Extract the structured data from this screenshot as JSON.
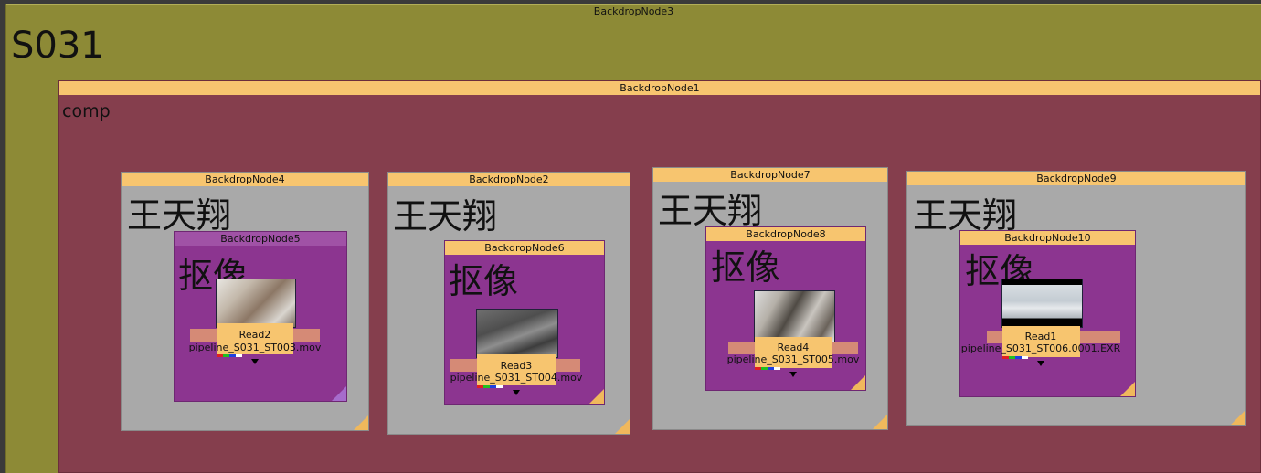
{
  "backdrop3": {
    "title": "BackdropNode3",
    "label": "S031"
  },
  "backdrop1": {
    "title": "BackdropNode1",
    "label": "comp"
  },
  "groups": [
    {
      "title": "BackdropNode4",
      "label": "王天翔",
      "inner": {
        "title": "BackdropNode5",
        "label": "抠像"
      },
      "read": {
        "name": "Read2",
        "file": "pipeline_S031_ST003.mov"
      }
    },
    {
      "title": "BackdropNode2",
      "label": "王天翔",
      "inner": {
        "title": "BackdropNode6",
        "label": "抠像"
      },
      "read": {
        "name": "Read3",
        "file": "pipeline_S031_ST004.mov"
      }
    },
    {
      "title": "BackdropNode7",
      "label": "王天翔",
      "inner": {
        "title": "BackdropNode8",
        "label": "抠像"
      },
      "read": {
        "name": "Read4",
        "file": "pipeline_S031_ST005.mov"
      }
    },
    {
      "title": "BackdropNode9",
      "label": "王天翔",
      "inner": {
        "title": "BackdropNode10",
        "label": "抠像"
      },
      "read": {
        "name": "Read1",
        "file": "pipeline_S031_ST006.0001.EXR"
      }
    }
  ],
  "colors": {
    "backdrop3": "#8d8a36",
    "backdrop1": "#853e4d",
    "group": "#a9a9a9",
    "inner": "#8c3590",
    "header": "#f7c56f"
  }
}
